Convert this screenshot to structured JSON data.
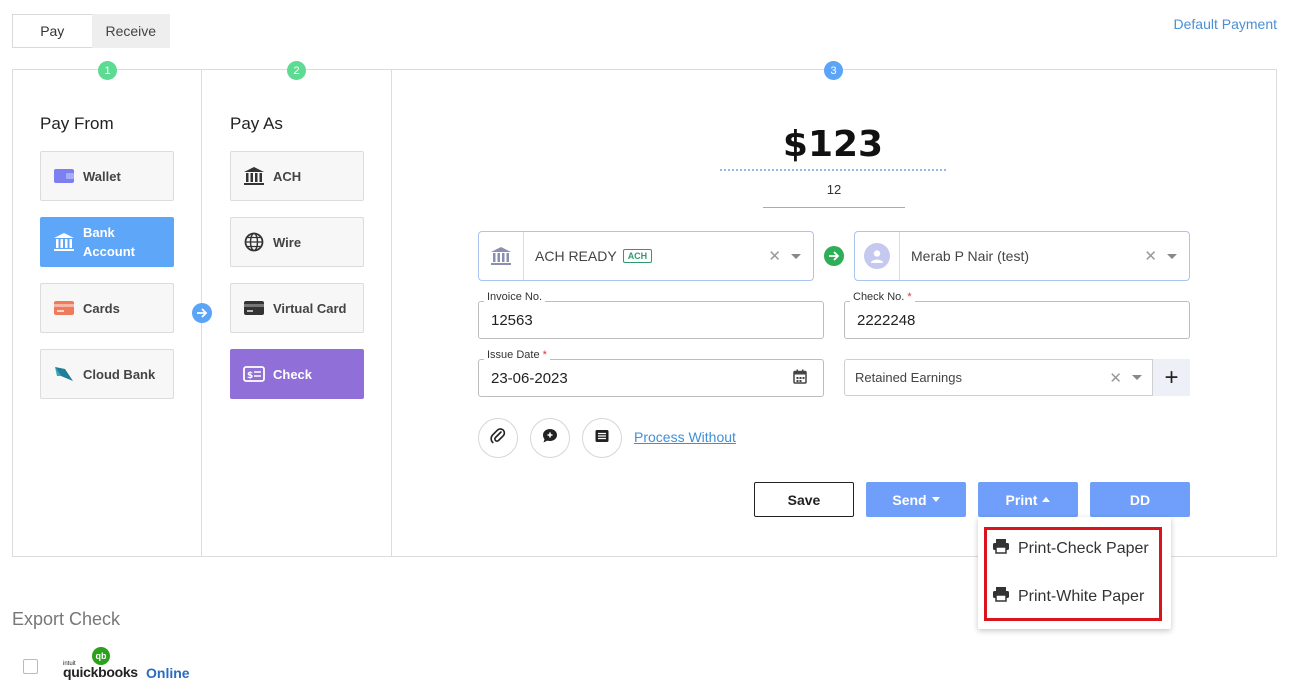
{
  "tabs": {
    "pay": "Pay",
    "receive": "Receive"
  },
  "default_payment_link": "Default Payment",
  "steps": [
    "1",
    "2",
    "3"
  ],
  "pay_from": {
    "title": "Pay From",
    "options": [
      {
        "label": "Wallet",
        "icon": "wallet-icon",
        "selected": false
      },
      {
        "label_line1": "Bank",
        "label_line2": "Account",
        "icon": "bank-icon",
        "selected": true
      },
      {
        "label": "Cards",
        "icon": "card-icon",
        "selected": false
      },
      {
        "label": "Cloud Bank",
        "icon": "cloud-bank-icon",
        "selected": false
      }
    ]
  },
  "pay_as": {
    "title": "Pay As",
    "options": [
      {
        "label": "ACH",
        "icon": "bank-icon",
        "selected": false
      },
      {
        "label": "Wire",
        "icon": "globe-icon",
        "selected": false
      },
      {
        "label": "Virtual Card",
        "icon": "virtual-card-icon",
        "selected": false
      },
      {
        "label": "Check",
        "icon": "check-icon",
        "selected": true
      }
    ]
  },
  "amount": "$123",
  "memo": "12",
  "from_account": {
    "name": "ACH READY",
    "badge": "ACH"
  },
  "to_payee": {
    "name": "Merab P Nair (test)"
  },
  "invoice": {
    "label": "Invoice No.",
    "value": "12563"
  },
  "check_no": {
    "label": "Check No.",
    "required_mark": "*",
    "value": "2222248"
  },
  "issue_date": {
    "label": "Issue Date",
    "required_mark": "*",
    "value": "23-06-2023"
  },
  "category": {
    "value": "Retained Earnings"
  },
  "plus": "+",
  "process_without": "Process Without",
  "buttons": {
    "save": "Save",
    "send": "Send",
    "print": "Print",
    "dd": "DD"
  },
  "print_menu": [
    "Print-Check Paper",
    "Print-White Paper"
  ],
  "export": {
    "title": "Export Check",
    "qb_small": "intuit",
    "qb_name": "quickbooks",
    "qb_online": "Online",
    "qb_badge": "qb"
  },
  "colors": {
    "accent_blue": "#6f9ffb",
    "check_purple": "#9070d8",
    "bank_blue": "#5ea6f7",
    "highlight_red": "#d9141f"
  }
}
